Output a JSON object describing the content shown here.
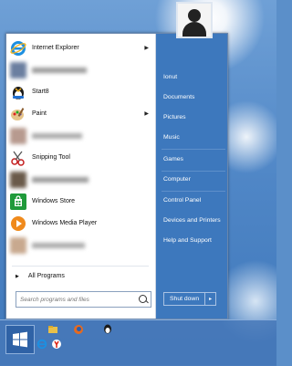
{
  "programs": [
    {
      "label": "Internet Explorer",
      "has_arrow": true,
      "icon": "ie-icon"
    },
    {
      "label": "",
      "blurred": true,
      "icon": "blurred-app-icon"
    },
    {
      "label": "Start8",
      "has_arrow": false,
      "icon": "start8-icon"
    },
    {
      "label": "Paint",
      "has_arrow": true,
      "icon": "paint-icon"
    },
    {
      "label": "",
      "blurred": true,
      "icon": "blurred-app-icon"
    },
    {
      "label": "Snipping Tool",
      "has_arrow": false,
      "icon": "scissors-icon"
    },
    {
      "label": "",
      "blurred": true,
      "icon": "blurred-app-icon"
    },
    {
      "label": "Windows Store",
      "has_arrow": false,
      "icon": "store-icon"
    },
    {
      "label": "Windows Media Player",
      "has_arrow": false,
      "icon": "media-player-icon"
    },
    {
      "label": "",
      "blurred": true,
      "icon": "blurred-app-icon"
    }
  ],
  "all_programs": "All Programs",
  "search": {
    "placeholder": "Search programs and files"
  },
  "right_menu": {
    "user": "Ionut",
    "documents": "Documents",
    "pictures": "Pictures",
    "music": "Music",
    "games": "Games",
    "computer": "Computer",
    "control_panel": "Control Panel",
    "devices": "Devices and Printers",
    "help": "Help and Support"
  },
  "shutdown": {
    "label": "Shut down",
    "arrow": "▸"
  },
  "colors": {
    "accent": "#3d78bd",
    "taskbar": "#4678b9"
  }
}
